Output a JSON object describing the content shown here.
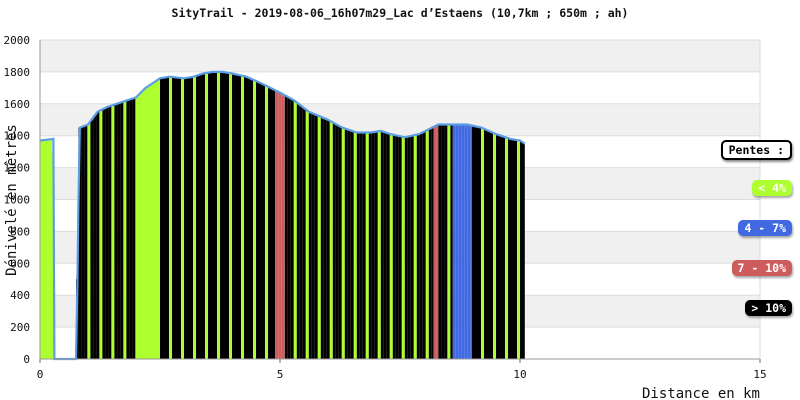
{
  "chart_data": {
    "type": "area",
    "title": "SityTrail - 2019-08-06_16h07m29_Lac d’Estaens (10,7km ; 650m ; ah)",
    "xlabel": "Distance en km",
    "ylabel": "Dénivelé en mètres",
    "xlim": [
      0,
      15
    ],
    "ylim": [
      0,
      2000
    ],
    "x_ticks": [
      "0",
      "5",
      "10",
      "15"
    ],
    "y_ticks": [
      "0",
      "200",
      "400",
      "600",
      "800",
      "1000",
      "1200",
      "1400",
      "1600",
      "1800",
      "2000"
    ],
    "grid": true,
    "legend_position": "right",
    "legend_title": "Pentes :",
    "legend": [
      {
        "label": "< 4%",
        "color": "#adff2f"
      },
      {
        "label": "4 - 7%",
        "color": "#4169e1"
      },
      {
        "label": "7 - 10%",
        "color": "#cd5c5c"
      },
      {
        "label": "> 10%",
        "color": "#000000"
      }
    ],
    "elevation_line_color": "#5b9ee6",
    "profile": [
      {
        "x": 0.0,
        "y": 1370
      },
      {
        "x": 0.15,
        "y": 1375
      },
      {
        "x": 0.28,
        "y": 1380
      },
      {
        "x": 0.3,
        "y": 0
      },
      {
        "x": 0.75,
        "y": 0
      },
      {
        "x": 0.78,
        "y": 470
      },
      {
        "x": 0.8,
        "y": 960
      },
      {
        "x": 0.83,
        "y": 1450
      },
      {
        "x": 1.0,
        "y": 1470
      },
      {
        "x": 1.2,
        "y": 1550
      },
      {
        "x": 1.4,
        "y": 1580
      },
      {
        "x": 1.6,
        "y": 1600
      },
      {
        "x": 1.8,
        "y": 1620
      },
      {
        "x": 2.0,
        "y": 1640
      },
      {
        "x": 2.2,
        "y": 1700
      },
      {
        "x": 2.4,
        "y": 1740
      },
      {
        "x": 2.5,
        "y": 1760
      },
      {
        "x": 2.7,
        "y": 1770
      },
      {
        "x": 3.0,
        "y": 1760
      },
      {
        "x": 3.2,
        "y": 1770
      },
      {
        "x": 3.4,
        "y": 1790
      },
      {
        "x": 3.6,
        "y": 1800
      },
      {
        "x": 3.8,
        "y": 1800
      },
      {
        "x": 4.0,
        "y": 1790
      },
      {
        "x": 4.3,
        "y": 1770
      },
      {
        "x": 4.6,
        "y": 1730
      },
      {
        "x": 5.0,
        "y": 1670
      },
      {
        "x": 5.3,
        "y": 1620
      },
      {
        "x": 5.6,
        "y": 1550
      },
      {
        "x": 6.0,
        "y": 1500
      },
      {
        "x": 6.3,
        "y": 1450
      },
      {
        "x": 6.6,
        "y": 1420
      },
      {
        "x": 6.9,
        "y": 1420
      },
      {
        "x": 7.1,
        "y": 1430
      },
      {
        "x": 7.3,
        "y": 1410
      },
      {
        "x": 7.6,
        "y": 1390
      },
      {
        "x": 7.9,
        "y": 1410
      },
      {
        "x": 8.1,
        "y": 1440
      },
      {
        "x": 8.3,
        "y": 1470
      },
      {
        "x": 8.6,
        "y": 1470
      },
      {
        "x": 8.9,
        "y": 1470
      },
      {
        "x": 9.2,
        "y": 1450
      },
      {
        "x": 9.5,
        "y": 1410
      },
      {
        "x": 9.8,
        "y": 1380
      },
      {
        "x": 10.0,
        "y": 1370
      },
      {
        "x": 10.1,
        "y": 1350
      }
    ],
    "slope_segments": [
      {
        "from": 0.0,
        "to": 0.3,
        "slope": "< 4%"
      },
      {
        "from": 0.75,
        "to": 0.8,
        "slope": "> 10%"
      },
      {
        "from": 0.8,
        "to": 2.0,
        "slope": "> 10%"
      },
      {
        "from": 2.0,
        "to": 2.5,
        "slope": "< 4%"
      },
      {
        "from": 2.5,
        "to": 4.9,
        "slope": "> 10%"
      },
      {
        "from": 4.9,
        "to": 5.1,
        "slope": "7 - 10%"
      },
      {
        "from": 5.1,
        "to": 8.2,
        "slope": "> 10%"
      },
      {
        "from": 8.2,
        "to": 8.3,
        "slope": "7 - 10%"
      },
      {
        "from": 8.3,
        "to": 8.6,
        "slope": "> 10%"
      },
      {
        "from": 8.6,
        "to": 9.0,
        "slope": "4 - 7%"
      },
      {
        "from": 9.0,
        "to": 10.1,
        "slope": "> 10%"
      }
    ]
  }
}
